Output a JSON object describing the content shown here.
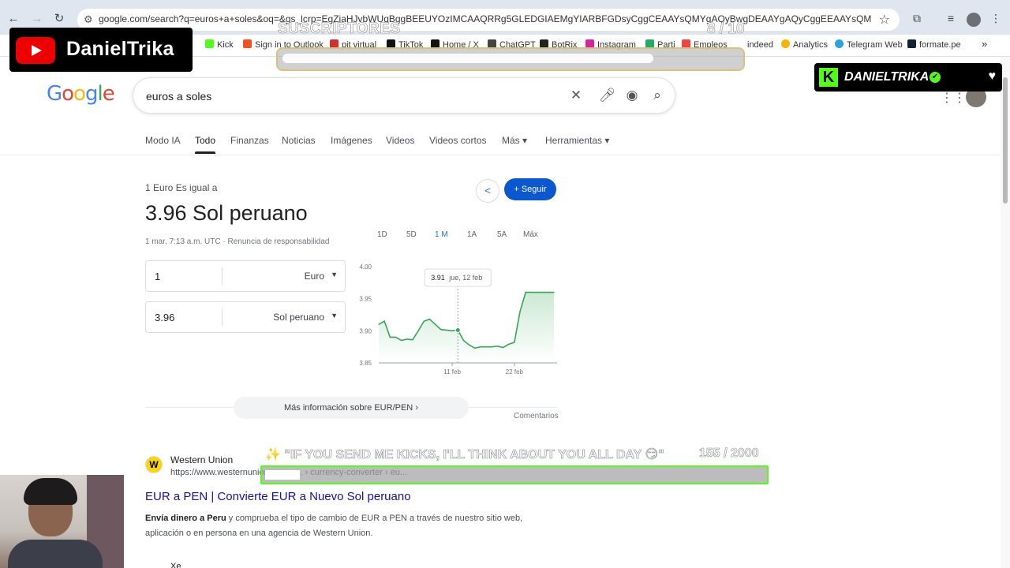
{
  "browser": {
    "url": "google.com/search?q=euros+a+soles&oq=&gs_lcrp=EgZjaHJvbWUqBggBEEUYOzIMCAAQRRg5GLEDGIAEMgYIARBFGDsyCggCEAAYsQMYgAQyBwgDEAAYgAQyCggEEAAYsQMYgAQyBwgFEAAYgA...",
    "bookmarks": [
      "Kick",
      "Sign in to Outlook",
      "pit virtual",
      "TikTok",
      "Home / X",
      "ChatGPT",
      "BotRix",
      "Instagram",
      "Parti",
      "Empleos",
      "indeed",
      "Analytics",
      "Telegram Web",
      "formate.pe"
    ]
  },
  "overlays": {
    "youtube_name": "DanielTrika",
    "subs_label": "SUSCRIPTORES",
    "subs_count": "8 / 10",
    "kick_name": "DANIELTRIKA",
    "kicks_message": "✨ \"IF YOU SEND ME KICKS, I'LL THINK ABOUT YOU ALL DAY 😏\"",
    "kicks_count": "155 / 2000"
  },
  "google": {
    "logo": "Google",
    "query": "euros a soles",
    "tabs": [
      "Modo IA",
      "Todo",
      "Finanzas",
      "Noticias",
      "Imágenes",
      "Videos",
      "Videos cortos",
      "Más ▾",
      "Herramientas ▾"
    ]
  },
  "converter": {
    "subtitle": "1 Euro Es igual a",
    "result": "3.96 Sol peruano",
    "date": "1 mar, 7:13 a.m. UTC · Renuncia de responsabilidad",
    "follow_label": "Seguir",
    "from_value": "1",
    "from_currency": "Euro",
    "to_value": "3.96",
    "to_currency": "Sol peruano",
    "ranges": [
      "1D",
      "5D",
      "1 M",
      "1A",
      "5A",
      "Máx"
    ],
    "active_range": "1 M",
    "more_info": "Más información sobre EUR/PEN",
    "comments": "Comentarios"
  },
  "chart_data": {
    "type": "line",
    "x": [
      "29 ene",
      "30 ene",
      "31 ene",
      "1 feb",
      "2 feb",
      "3 feb",
      "4 feb",
      "5 feb",
      "6 feb",
      "7 feb",
      "8 feb",
      "9 feb",
      "10 feb",
      "11 feb",
      "12 feb",
      "13 feb",
      "14 feb",
      "15 feb",
      "16 feb",
      "17 feb",
      "18 feb",
      "19 feb",
      "20 feb",
      "21 feb",
      "22 feb",
      "23 feb",
      "24 feb",
      "25 feb",
      "26 feb",
      "27 feb",
      "28 feb",
      "1 mar"
    ],
    "y": [
      3.91,
      3.915,
      3.89,
      3.89,
      3.885,
      3.887,
      3.886,
      3.9,
      3.915,
      3.918,
      3.91,
      3.902,
      3.901,
      3.9,
      3.901,
      3.885,
      3.878,
      3.873,
      3.875,
      3.875,
      3.875,
      3.876,
      3.874,
      3.879,
      3.882,
      3.93,
      3.96,
      3.96,
      3.96,
      3.96,
      3.96,
      3.96
    ],
    "ylim": [
      3.85,
      4.0
    ],
    "yticks": [
      "3.85",
      "3.90",
      "3.95",
      "4.00"
    ],
    "xticks": [
      "11 feb",
      "22 feb"
    ],
    "tooltip": {
      "value": "3.91",
      "label": "jue, 12 feb"
    },
    "line_color": "#34a853"
  },
  "result": {
    "site": "Western Union",
    "url": "https://www.westernunion.com › ... › currency-converter › eu...",
    "title": "EUR a PEN | Convierte EUR a Nuevo Sol peruano",
    "snippet_bold": "Envía dinero a Peru",
    "snippet_rest": " y comprueba el tipo de cambio de EUR a PEN a través de nuestro sitio web, aplicación o en persona en una agencia de Western Union.",
    "next_site": "Xe"
  }
}
